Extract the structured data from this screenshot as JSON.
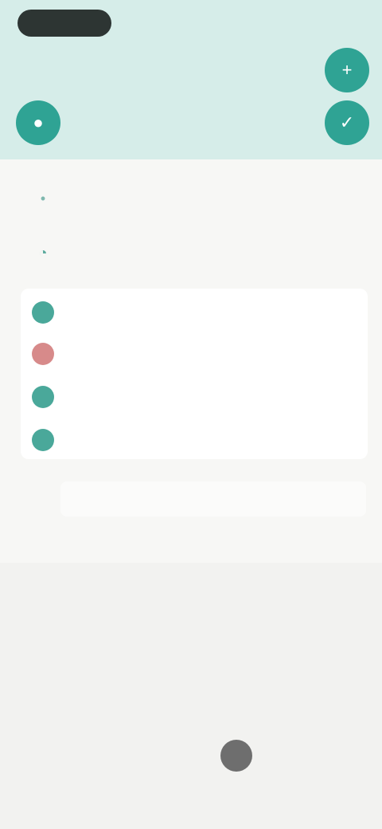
{
  "status_bar": {
    "left_pill": "",
    "right_text": ""
  },
  "header": {
    "side_label": "",
    "fab_top_icon": "plus-icon",
    "fab_mid_icon": "check-icon",
    "fab_left_icon": "category-icon"
  },
  "form": {
    "first_row": {
      "text": "",
      "right": ""
    },
    "second_row": {
      "text": "",
      "right": ""
    }
  },
  "categories": [
    {
      "label": "",
      "color": "#4aa89a"
    },
    {
      "label": "",
      "color": "#d78a8a"
    },
    {
      "label": "",
      "color": "#4aa89a"
    },
    {
      "label": "",
      "color": "#4aa89a"
    }
  ],
  "note": {
    "text": "",
    "hint": ""
  },
  "keypad": {
    "keys": [
      [
        "",
        "",
        "",
        ""
      ],
      [
        "",
        "",
        "",
        ""
      ],
      [
        "",
        "",
        "",
        ""
      ],
      [
        "",
        "",
        "",
        ""
      ]
    ]
  }
}
